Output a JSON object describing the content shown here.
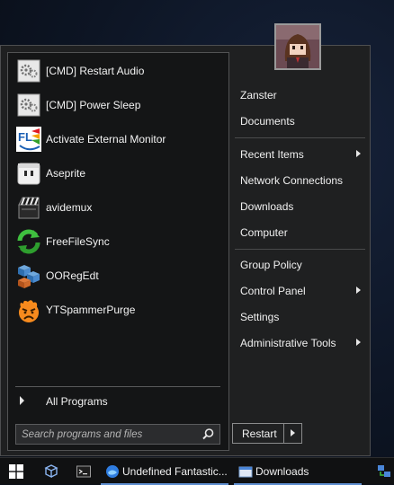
{
  "programs": [
    {
      "label": "[CMD] Restart Audio",
      "icon": "cmd-gears-icon"
    },
    {
      "label": "[CMD] Power Sleep",
      "icon": "cmd-gears-icon"
    },
    {
      "label": "Activate External Monitor",
      "icon": "flow-launcher-icon"
    },
    {
      "label": "Aseprite",
      "icon": "aseprite-icon"
    },
    {
      "label": "avidemux",
      "icon": "clapperboard-icon"
    },
    {
      "label": "FreeFileSync",
      "icon": "sync-arrows-icon"
    },
    {
      "label": "OORegEdt",
      "icon": "registry-cubes-icon"
    },
    {
      "label": "YTSpammerPurge",
      "icon": "angry-emoji-icon"
    }
  ],
  "all_programs": {
    "label": "All Programs"
  },
  "search": {
    "placeholder": "Search programs and files"
  },
  "user": {
    "name": "Zanster"
  },
  "right_items": [
    {
      "label": "Zanster",
      "submenu": false
    },
    {
      "label": "Documents",
      "submenu": false
    },
    {
      "label": "Recent Items",
      "submenu": true
    },
    {
      "label": "Network Connections",
      "submenu": false
    },
    {
      "label": "Downloads",
      "submenu": false
    },
    {
      "label": "Computer",
      "submenu": false
    },
    {
      "label": "Group Policy",
      "submenu": false
    },
    {
      "label": "Control Panel",
      "submenu": true
    },
    {
      "label": "Settings",
      "submenu": false
    },
    {
      "label": "Administrative Tools",
      "submenu": true
    }
  ],
  "shutdown": {
    "label": "Restart"
  },
  "taskbar": {
    "items": [
      {
        "label": "",
        "icon": "windows-start-icon"
      },
      {
        "label": "",
        "icon": "cube-icon"
      },
      {
        "label": "",
        "icon": "terminal-icon"
      },
      {
        "label": "Undefined Fantastic...",
        "icon": "browser-icon"
      },
      {
        "label": "Downloads",
        "icon": "folder-window-icon"
      },
      {
        "label": "",
        "icon": "network-tray-icon"
      }
    ]
  },
  "colors": {
    "menu_bg": "#1f2021",
    "panel_bg": "#141516",
    "taskbar_bg": "#101112",
    "accent": "#5f8fd0"
  }
}
